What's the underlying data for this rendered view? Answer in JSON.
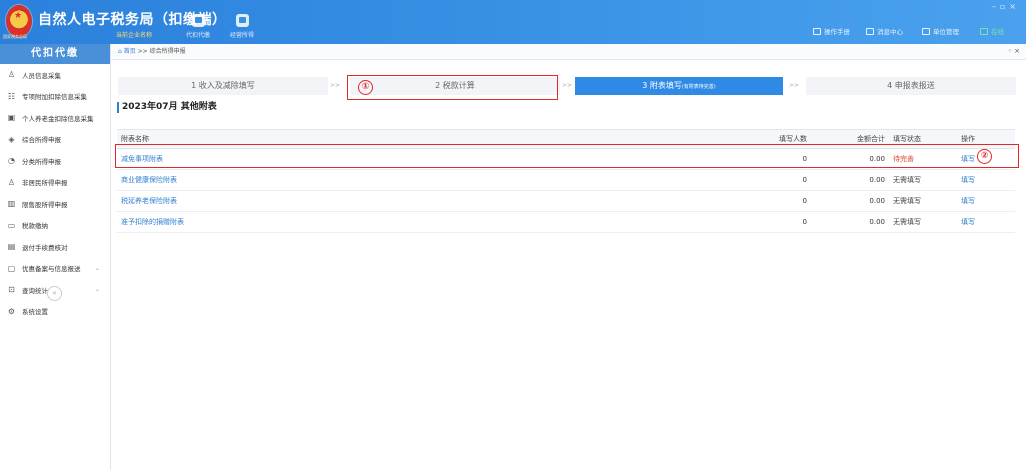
{
  "app": {
    "logo_text": "国家税务总局",
    "title": "自然人电子税务局（扣缴端）",
    "subtitle": "当前企业名称"
  },
  "top_nav": [
    {
      "label": "代扣代缴",
      "icon": "briefcase-icon"
    },
    {
      "label": "经营所得",
      "icon": "coin-stack-icon"
    }
  ],
  "toolbar": {
    "manual": "操作手册",
    "messages": "消息中心",
    "unit_mgmt": "单位管理",
    "online": "在线"
  },
  "sidebar": {
    "header": "代扣代缴",
    "items": [
      {
        "label": "人员信息采集",
        "icon": "person-icon"
      },
      {
        "label": "专项附加扣除信息采集",
        "icon": "grid-icon"
      },
      {
        "label": "个人养老金扣除信息采集",
        "icon": "card-icon"
      },
      {
        "label": "综合所得申报",
        "icon": "layers-icon"
      },
      {
        "label": "分类所得申报",
        "icon": "pie-icon"
      },
      {
        "label": "非居民所得申报",
        "icon": "person-outline-icon"
      },
      {
        "label": "限售股所得申报",
        "icon": "bar-chart-icon"
      },
      {
        "label": "税款缴纳",
        "icon": "folder-icon"
      },
      {
        "label": "退付手续费核对",
        "icon": "receipt-icon"
      },
      {
        "label": "优惠备案与信息报送",
        "icon": "document-icon"
      },
      {
        "label": "查询统计",
        "icon": "search-chart-icon"
      },
      {
        "label": "系统设置",
        "icon": "gear-icon"
      }
    ],
    "collapse": "«"
  },
  "breadcrumb": {
    "home": "首页",
    "sep": " >> ",
    "current": "综合所得申报"
  },
  "steps": [
    {
      "label": "1 收入及减除填写"
    },
    {
      "label": "2 税款计算"
    },
    {
      "label": "3 附表填写",
      "note": "(有附表待完善)"
    },
    {
      "label": "4 申报表报送"
    }
  ],
  "step_sep": ">>",
  "section_title": "2023年07月 其他附表",
  "table": {
    "headers": [
      "附表名称",
      "填写人数",
      "金额合计",
      "填写状态",
      "操作"
    ],
    "rows": [
      {
        "name": "减免事项附表",
        "count": "0",
        "amount": "0.00",
        "status": "待完善",
        "action": "填写"
      },
      {
        "name": "商业健康保险附表",
        "count": "0",
        "amount": "0.00",
        "status": "无需填写",
        "action": "填写"
      },
      {
        "name": "税延养老保险附表",
        "count": "0",
        "amount": "0.00",
        "status": "无需填写",
        "action": "填写"
      },
      {
        "name": "准予扣除的捐赠附表",
        "count": "0",
        "amount": "0.00",
        "status": "无需填写",
        "action": "填写"
      }
    ]
  },
  "annotations": [
    "①",
    "②"
  ],
  "colors": {
    "header_blue": "#2b80db",
    "active_step": "#2f8ae6",
    "link": "#2f7fd1",
    "pending": "#e0452b",
    "annotation": "#e02a2a"
  }
}
